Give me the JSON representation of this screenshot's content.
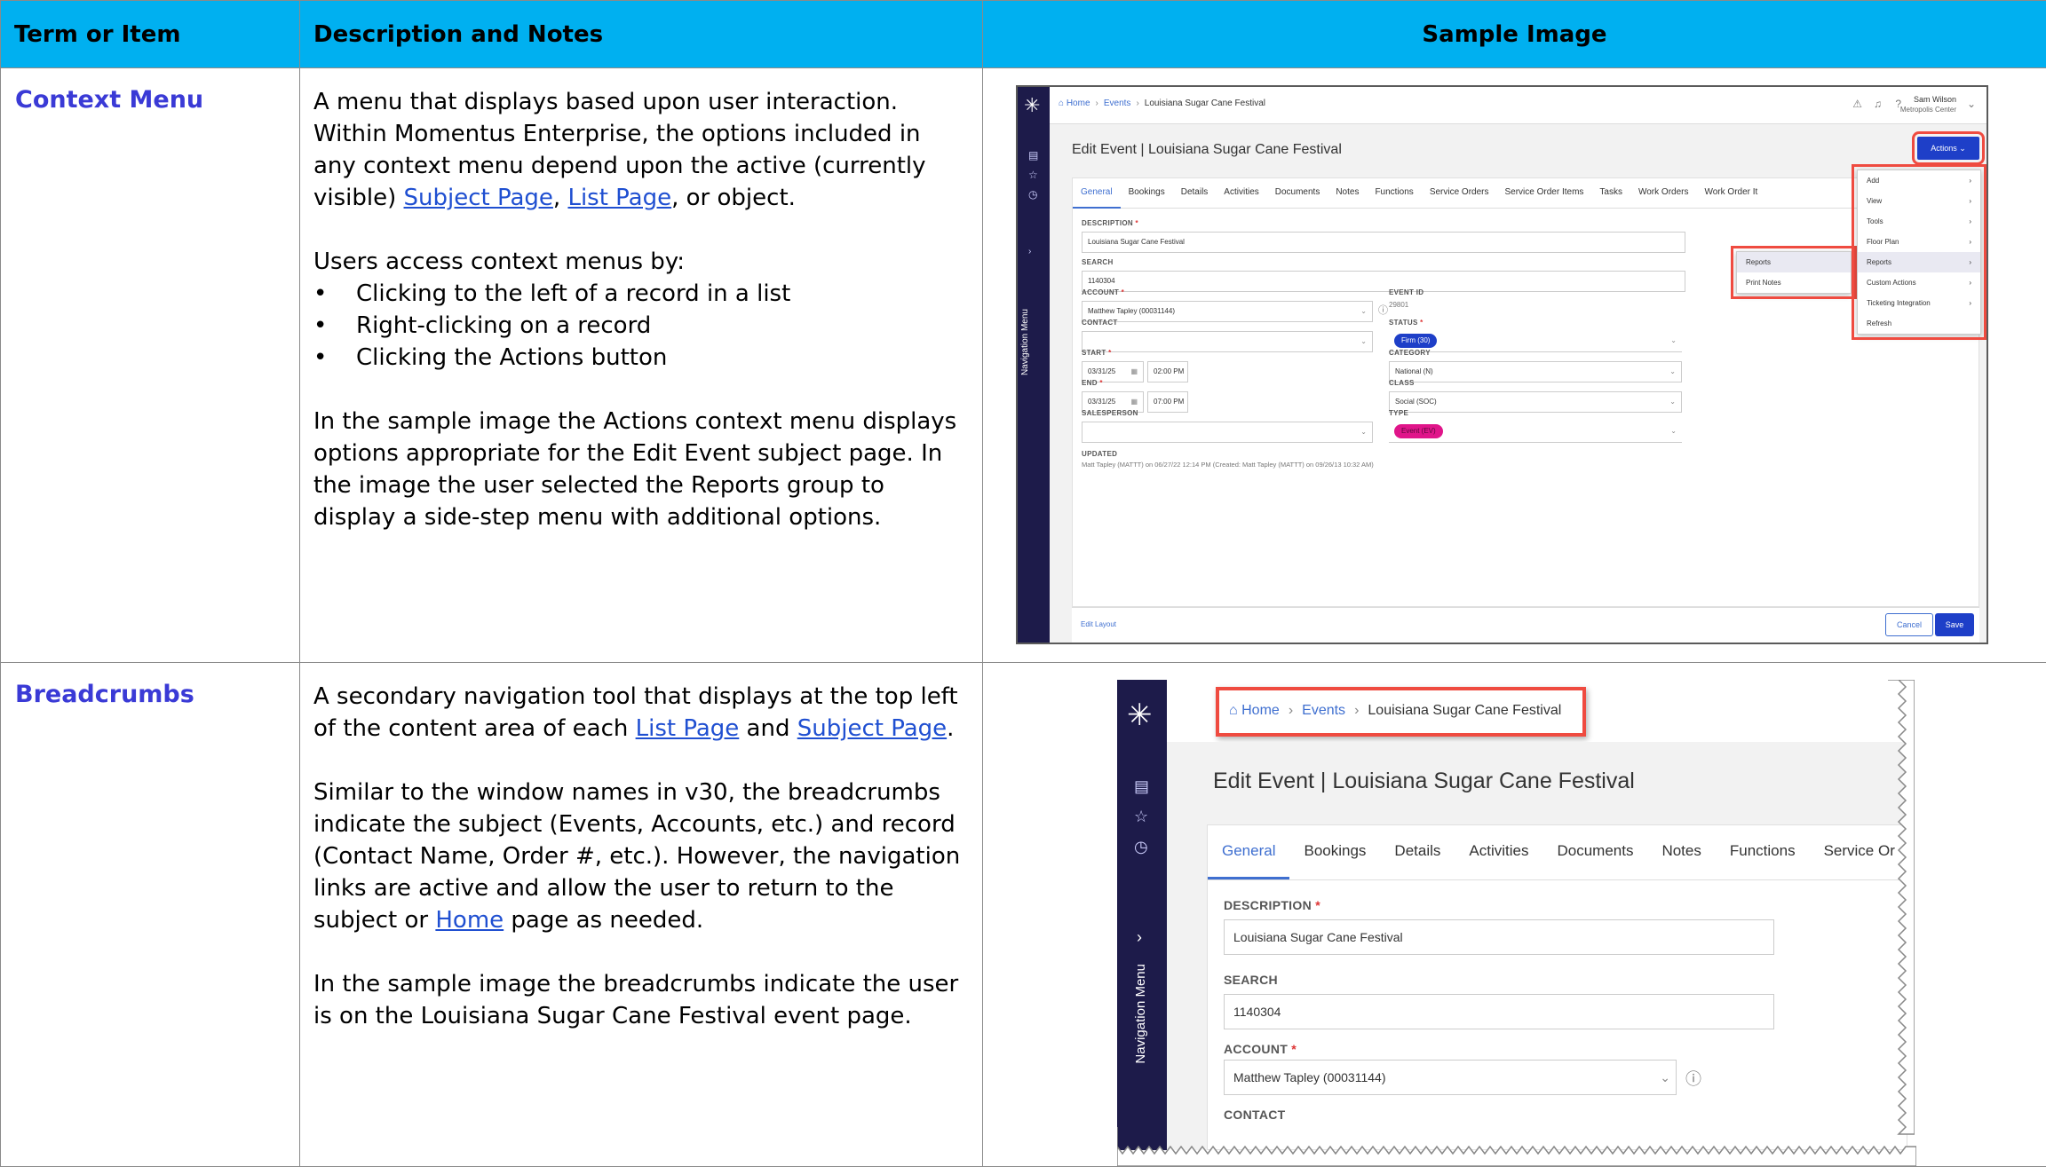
{
  "headers": {
    "term": "Term or Item",
    "description": "Description and Notes",
    "sample": "Sample Image"
  },
  "rows": [
    {
      "term": "Context Menu",
      "p1_a": "A menu that displays based upon user interaction. Within Momentus Enterprise, the options included in any context menu depend upon the active (currently visible) ",
      "p1_link1": "Subject Page",
      "p1_b": ", ",
      "p1_link2": "List Page",
      "p1_c": ", or object.",
      "p2": "Users access context menus by:",
      "bullets": [
        "Clicking to the left of a record in a list",
        "Right-clicking on a record",
        "Clicking the Actions button"
      ],
      "p3": "In the sample image the Actions context menu displays options appropriate for the Edit Event subject page. In the image the user selected the Reports group to display a side-step menu with additional options."
    },
    {
      "term": "Breadcrumbs",
      "p1_a": "A secondary navigation tool that displays at the top left of the content area of each ",
      "p1_link1": "List Page",
      "p1_b": " and ",
      "p1_link2": "Subject Page",
      "p1_c": ".",
      "p2_a": "Similar to the window names in v30, the breadcrumbs indicate the subject (Events, Accounts, etc.) and record (Contact Name, Order #, etc.). However, the navigation links are active and allow the user to return to the subject or ",
      "p2_link": "Home",
      "p2_b": " page as needed.",
      "p3": "In the sample image the breadcrumbs indicate the user is on the Louisiana Sugar Cane Festival event page."
    }
  ],
  "sample1": {
    "breadcrumb": [
      "Home",
      "Events",
      "Louisiana Sugar Cane Festival"
    ],
    "user_name": "Sam Wilson",
    "user_venue": "Metropolis Center",
    "title": "Edit Event | Louisiana Sugar Cane Festival",
    "actions_label": "Actions",
    "tabs": [
      "General",
      "Bookings",
      "Details",
      "Activities",
      "Documents",
      "Notes",
      "Functions",
      "Service Orders",
      "Service Order Items",
      "Tasks",
      "Work Orders",
      "Work Order It"
    ],
    "fields": {
      "description_label": "DESCRIPTION",
      "description_value": "Louisiana Sugar Cane Festival",
      "search_label": "SEARCH",
      "search_value": "1140304",
      "account_label": "ACCOUNT",
      "account_value": "Matthew Tapley (00031144)",
      "event_id_label": "EVENT ID",
      "event_id_value": "29801",
      "contact_label": "CONTACT",
      "status_label": "STATUS",
      "status_value": "Firm (30)",
      "start_label": "START",
      "start_date": "03/31/25",
      "start_time": "02:00 PM",
      "category_label": "CATEGORY",
      "category_value": "National (N)",
      "end_label": "END",
      "end_date": "03/31/25",
      "end_time": "07:00 PM",
      "class_label": "CLASS",
      "class_value": "Social (SOC)",
      "salesperson_label": "SALESPERSON",
      "type_label": "TYPE",
      "type_value": "Event (EV)",
      "updated_label": "UPDATED",
      "updated_value": "Matt Tapley (MATTT) on 06/27/22 12:14 PM (Created: Matt Tapley (MATTT) on 09/26/13 10:32 AM)"
    },
    "menu": [
      "Add",
      "View",
      "Tools",
      "Floor Plan",
      "Reports",
      "Custom Actions",
      "Ticketing Integration",
      "Refresh"
    ],
    "submenu": [
      "Reports",
      "Print Notes"
    ],
    "edit_layout": "Edit Layout",
    "cancel": "Cancel",
    "save": "Save",
    "nav_label": "Navigation Menu",
    "colors": {
      "nav": "#1d1b4a",
      "accent": "#1e3fc8",
      "highlight": "#ef4b40",
      "status_pill": "#1e3fc8",
      "type_pill": "#e0158a"
    }
  },
  "sample2": {
    "breadcrumb": [
      "Home",
      "Events",
      "Louisiana Sugar Cane Festival"
    ],
    "title": "Edit Event | Louisiana Sugar Cane Festival",
    "tabs": [
      "General",
      "Bookings",
      "Details",
      "Activities",
      "Documents",
      "Notes",
      "Functions",
      "Service Or"
    ],
    "fields": {
      "description_label": "DESCRIPTION",
      "description_value": "Louisiana Sugar Cane Festival",
      "search_label": "SEARCH",
      "search_value": "1140304",
      "account_label": "ACCOUNT",
      "account_value": "Matthew Tapley (00031144)",
      "contact_label": "CONTACT"
    },
    "nav_label": "Navigation Menu"
  }
}
